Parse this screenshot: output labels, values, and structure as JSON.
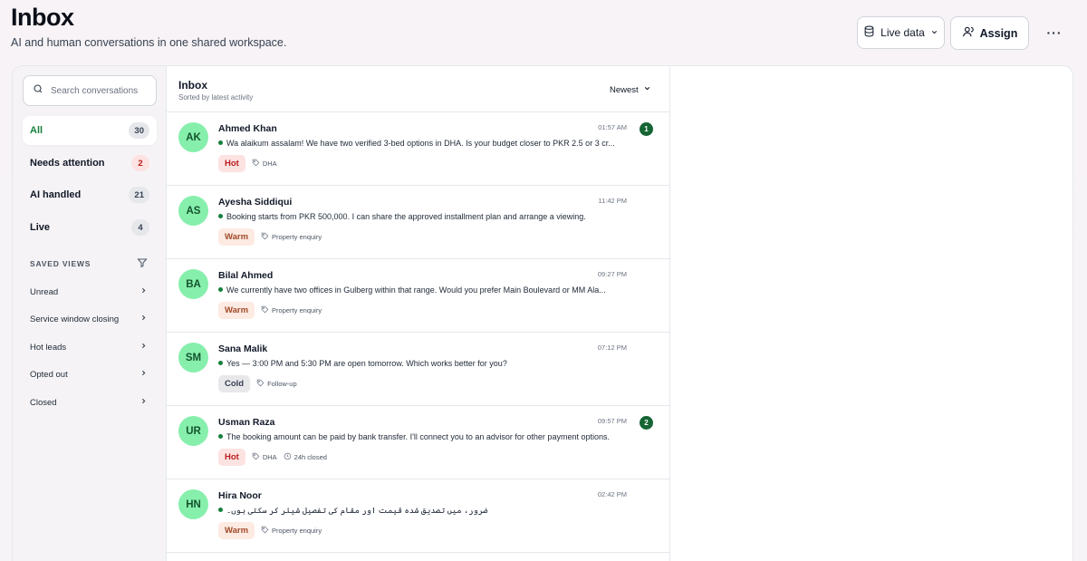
{
  "header": {
    "title": "Inbox",
    "subtitle": "AI and human conversations in one shared workspace.",
    "live_label": "Live data",
    "assign_label": "Assign",
    "more_label": "···"
  },
  "sidebar": {
    "search_placeholder": "Search conversations",
    "filters": [
      {
        "label": "All",
        "count": "30"
      },
      {
        "label": "Needs attention",
        "count": "2"
      },
      {
        "label": "AI handled",
        "count": "21"
      },
      {
        "label": "Live",
        "count": "4"
      }
    ],
    "saved_views_label": "SAVED VIEWS",
    "views": [
      {
        "label": "Unread"
      },
      {
        "label": "Service window closing"
      },
      {
        "label": "Hot leads"
      },
      {
        "label": "Opted out"
      },
      {
        "label": "Closed"
      }
    ]
  },
  "list": {
    "title": "Inbox",
    "subtitle": "Sorted by latest activity",
    "sort_label": "Newest",
    "conversations": [
      {
        "initials": "AK",
        "name": "Ahmed Khan",
        "time": "01:57 AM",
        "unread": "1",
        "message": "Wa alaikum assalam! We have two verified 3-bed options in DHA. Is your budget closer to PKR 2.5 or 3 cr...",
        "temp": "Hot",
        "tag": "DHA",
        "extra": ""
      },
      {
        "initials": "AS",
        "name": "Ayesha Siddiqui",
        "time": "11:42 PM",
        "unread": "",
        "message": "Booking starts from PKR 500,000. I can share the approved installment plan and arrange a viewing.",
        "temp": "Warm",
        "tag": "Property enquiry",
        "extra": ""
      },
      {
        "initials": "BA",
        "name": "Bilal Ahmed",
        "time": "09:27 PM",
        "unread": "",
        "message": "We currently have two offices in Gulberg within that range. Would you prefer Main Boulevard or MM Ala...",
        "temp": "Warm",
        "tag": "Property enquiry",
        "extra": ""
      },
      {
        "initials": "SM",
        "name": "Sana Malik",
        "time": "07:12 PM",
        "unread": "",
        "message": "Yes — 3:00 PM and 5:30 PM are open tomorrow. Which works better for you?",
        "temp": "Cold",
        "tag": "Follow-up",
        "extra": ""
      },
      {
        "initials": "UR",
        "name": "Usman Raza",
        "time": "09:57 PM",
        "unread": "2",
        "message": "The booking amount can be paid by bank transfer. I'll connect you to an advisor for other payment options.",
        "temp": "Hot",
        "tag": "DHA",
        "extra": "24h closed"
      },
      {
        "initials": "HN",
        "name": "Hira Noor",
        "time": "02:42 PM",
        "unread": "",
        "message": "ضرور، میں تصدیق شدہ قیمت اور مقام کی تفصیل شیئر کر سکتی ہوں۔",
        "temp": "Warm",
        "tag": "Property enquiry",
        "extra": ""
      }
    ]
  },
  "colors": {
    "accent": "#15803d",
    "avatar_bg": "#86efac",
    "hot": "#b91c1c",
    "warm": "#a14a28",
    "unread_badge": "#166534"
  },
  "icons": {
    "search": "search-icon",
    "database": "database-icon",
    "user": "user-icon",
    "more": "more-icon",
    "filter": "filter-icon",
    "chevron": "chevron-right-icon",
    "tag": "tag-icon",
    "clock": "clock-icon"
  }
}
